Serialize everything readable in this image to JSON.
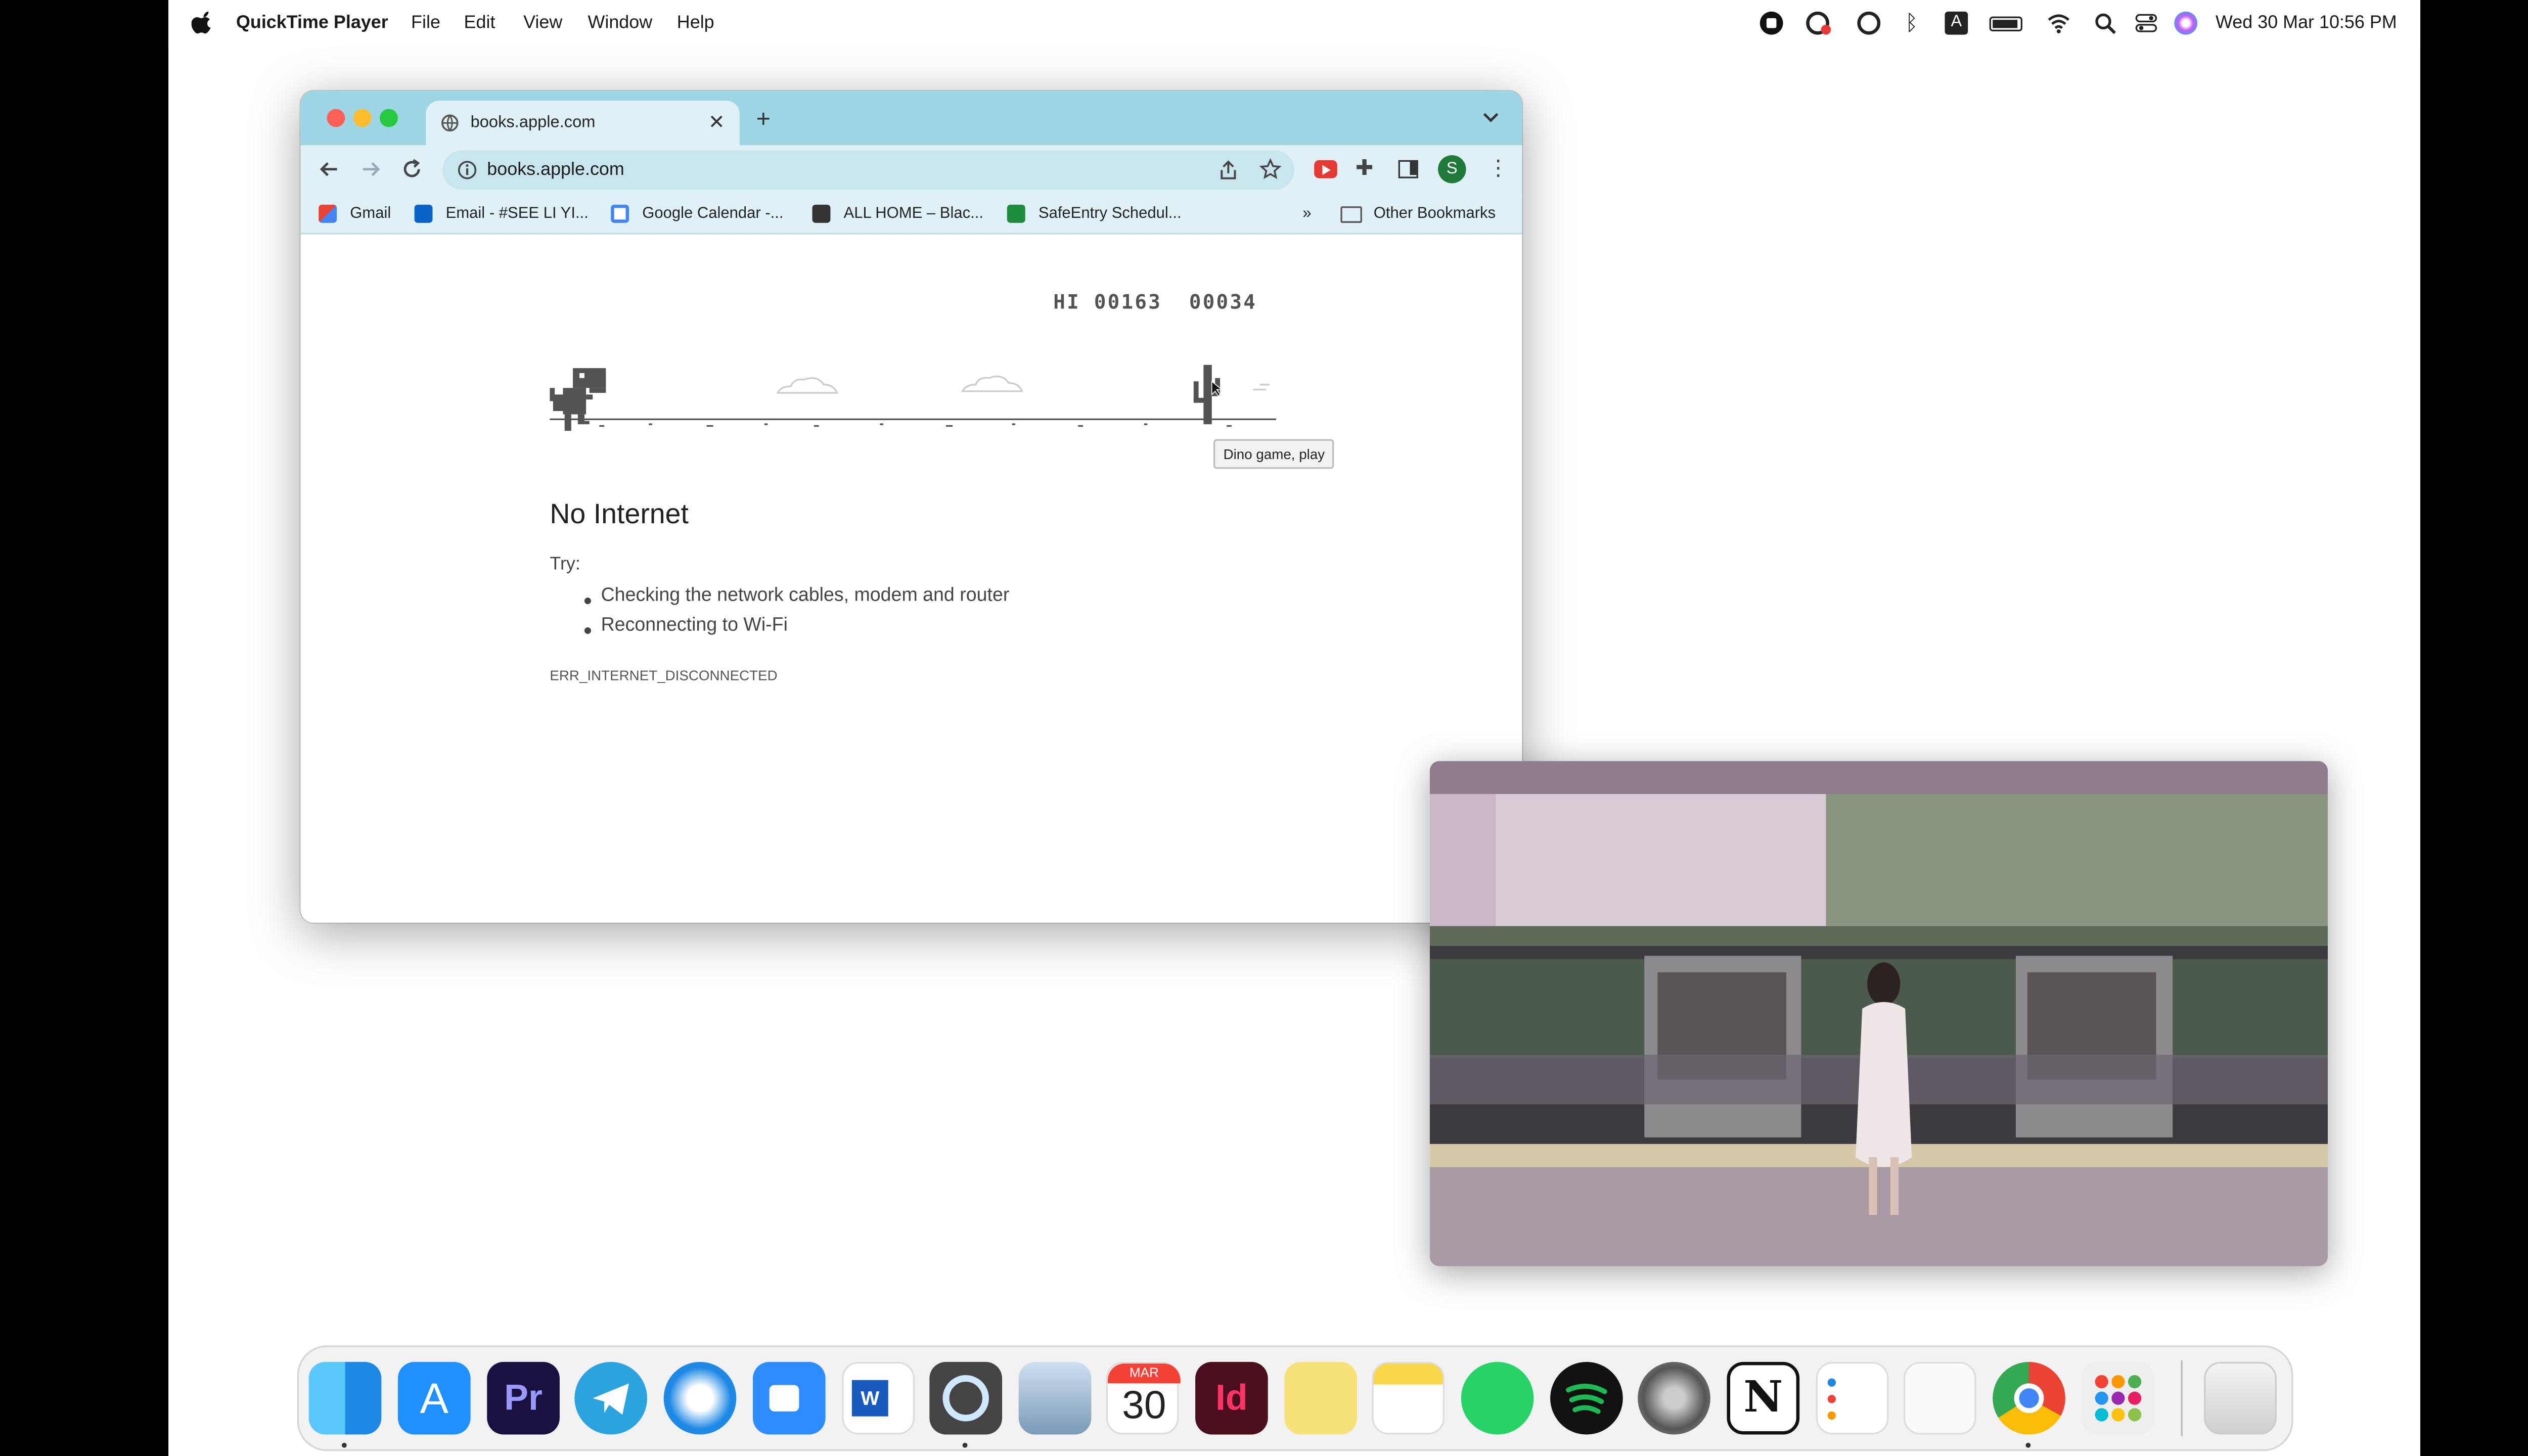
{
  "menubar": {
    "app_name": "QuickTime Player",
    "menus": [
      "File",
      "Edit",
      "View",
      "Window",
      "Help"
    ],
    "clock": "Wed 30 Mar  10:56 PM",
    "input_source": "A"
  },
  "browser": {
    "tab_title": "books.apple.com",
    "new_tab": "+",
    "url": "books.apple.com",
    "profile_initial": "S",
    "bookmarks": [
      {
        "label": "Gmail",
        "icon": "gmail-icon"
      },
      {
        "label": "Email - #SEE LI YI...",
        "icon": "outlook-icon"
      },
      {
        "label": "Google Calendar -...",
        "icon": "calendar-icon"
      },
      {
        "label": "ALL HOME – Blac...",
        "icon": "site-icon"
      },
      {
        "label": "SafeEntry Schedul...",
        "icon": "sheets-icon"
      }
    ],
    "overflow": "»",
    "other_bookmarks": "Other Bookmarks"
  },
  "page": {
    "score_hi": "HI 00163",
    "score": "00034",
    "tooltip": "Dino game, play",
    "heading": "No Internet",
    "try_label": "Try:",
    "suggestions": [
      "Checking the network cables, modem and router",
      "Reconnecting to Wi-Fi"
    ],
    "error_code": "ERR_INTERNET_DISCONNECTED"
  },
  "dock": {
    "calendar_month": "MAR",
    "calendar_day": "30",
    "apps": [
      "finder-icon",
      "app-store-icon",
      "premiere-icon",
      "telegram-icon",
      "safari-icon",
      "zoom-icon",
      "word-icon",
      "quicktime-icon",
      "preview-icon",
      "calendar-icon",
      "indesign-icon",
      "stickies-icon",
      "notes-icon",
      "whatsapp-icon",
      "spotify-icon",
      "system-preferences-icon",
      "notion-icon",
      "reminders-icon",
      "textedit-icon",
      "chrome-icon",
      "launchpad-icon",
      "trash-icon"
    ]
  }
}
